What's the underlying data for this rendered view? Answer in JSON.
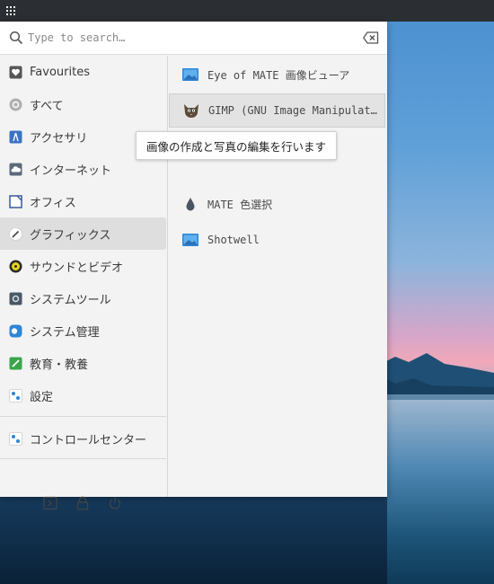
{
  "search": {
    "placeholder": "Type to search…"
  },
  "categories": [
    {
      "label": "Favourites",
      "icon": "heart-icon"
    },
    {
      "label": "すべて",
      "icon": "all-apps-icon"
    },
    {
      "label": "アクセサリ",
      "icon": "accessories-icon"
    },
    {
      "label": "インターネット",
      "icon": "internet-icon"
    },
    {
      "label": "オフィス",
      "icon": "office-icon"
    },
    {
      "label": "グラフィックス",
      "icon": "graphics-icon",
      "selected": true
    },
    {
      "label": "サウンドとビデオ",
      "icon": "sound-video-icon"
    },
    {
      "label": "システムツール",
      "icon": "system-tools-icon"
    },
    {
      "label": "システム管理",
      "icon": "administration-icon"
    },
    {
      "label": "教育・教養",
      "icon": "education-icon"
    },
    {
      "label": "設定",
      "icon": "settings-icon"
    }
  ],
  "control_center": {
    "label": "コントロールセンター",
    "icon": "control-center-icon"
  },
  "actions": [
    {
      "name": "terminal-icon"
    },
    {
      "name": "lock-icon"
    },
    {
      "name": "power-icon"
    }
  ],
  "apps": [
    {
      "label": "Eye of MATE 画像ビューア",
      "icon": "image-viewer-icon"
    },
    {
      "label": "GIMP (GNU Image Manipulation Program)",
      "icon": "gimp-icon",
      "hovered": true
    },
    {
      "label": "MATE 色選択",
      "icon": "color-picker-icon"
    },
    {
      "label": "Shotwell",
      "icon": "shotwell-icon"
    }
  ],
  "tooltip": {
    "text": "画像の作成と写真の編集を行います"
  },
  "colors": {
    "selected_bg": "#dedede",
    "menu_bg": "#f3f3f3",
    "topbar": "#2b2f33"
  }
}
